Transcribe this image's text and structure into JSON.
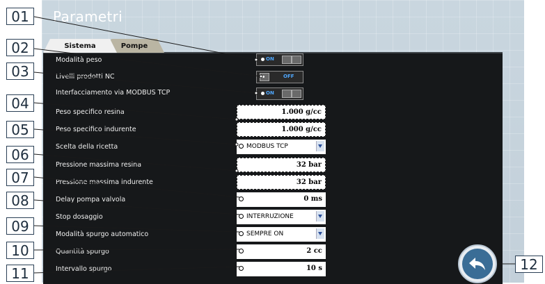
{
  "screen": {
    "title": "Parametri",
    "tabs": [
      {
        "label": "Sistema",
        "active": true
      },
      {
        "label": "Pompe",
        "active": false
      }
    ]
  },
  "rows": [
    {
      "label": "Modalità peso",
      "type": "toggle",
      "state": "ON"
    },
    {
      "label": "Livelli prodotti NC",
      "type": "toggle",
      "state": "OFF"
    },
    {
      "label": "Interfacciamento via MODBUS TCP",
      "type": "toggle",
      "state": "ON"
    },
    {
      "label": "Peso specifico resina",
      "type": "field",
      "value": "1.000 g/cc"
    },
    {
      "label": "Peso specifico indurente",
      "type": "field",
      "value": "1.000 g/cc"
    },
    {
      "label": "Scelta della ricetta",
      "type": "select",
      "value": "MODBUS TCP"
    },
    {
      "label": "Pressione massima resina",
      "type": "field",
      "value": "32 bar"
    },
    {
      "label": "Pressione massima indurente",
      "type": "field",
      "value": "32 bar"
    },
    {
      "label": "Delay pompa valvola",
      "type": "input",
      "value": "0 ms"
    },
    {
      "label": "Stop dosaggio",
      "type": "select",
      "value": "INTERRUZIONE"
    },
    {
      "label": "Modalità spurgo automatico",
      "type": "select",
      "value": "SEMPRE ON"
    },
    {
      "label": "Quantità spurgo",
      "type": "input",
      "value": "2 cc"
    },
    {
      "label": "Intervallo spurgo",
      "type": "input",
      "value": "10 s"
    }
  ],
  "callouts": [
    "01",
    "02",
    "03",
    "04",
    "05",
    "06",
    "07",
    "08",
    "09",
    "10",
    "11",
    "12"
  ],
  "colors": {
    "panel": "#16181a",
    "toggle_on": "#4fa8ff",
    "back_button": "#3a6d96"
  }
}
